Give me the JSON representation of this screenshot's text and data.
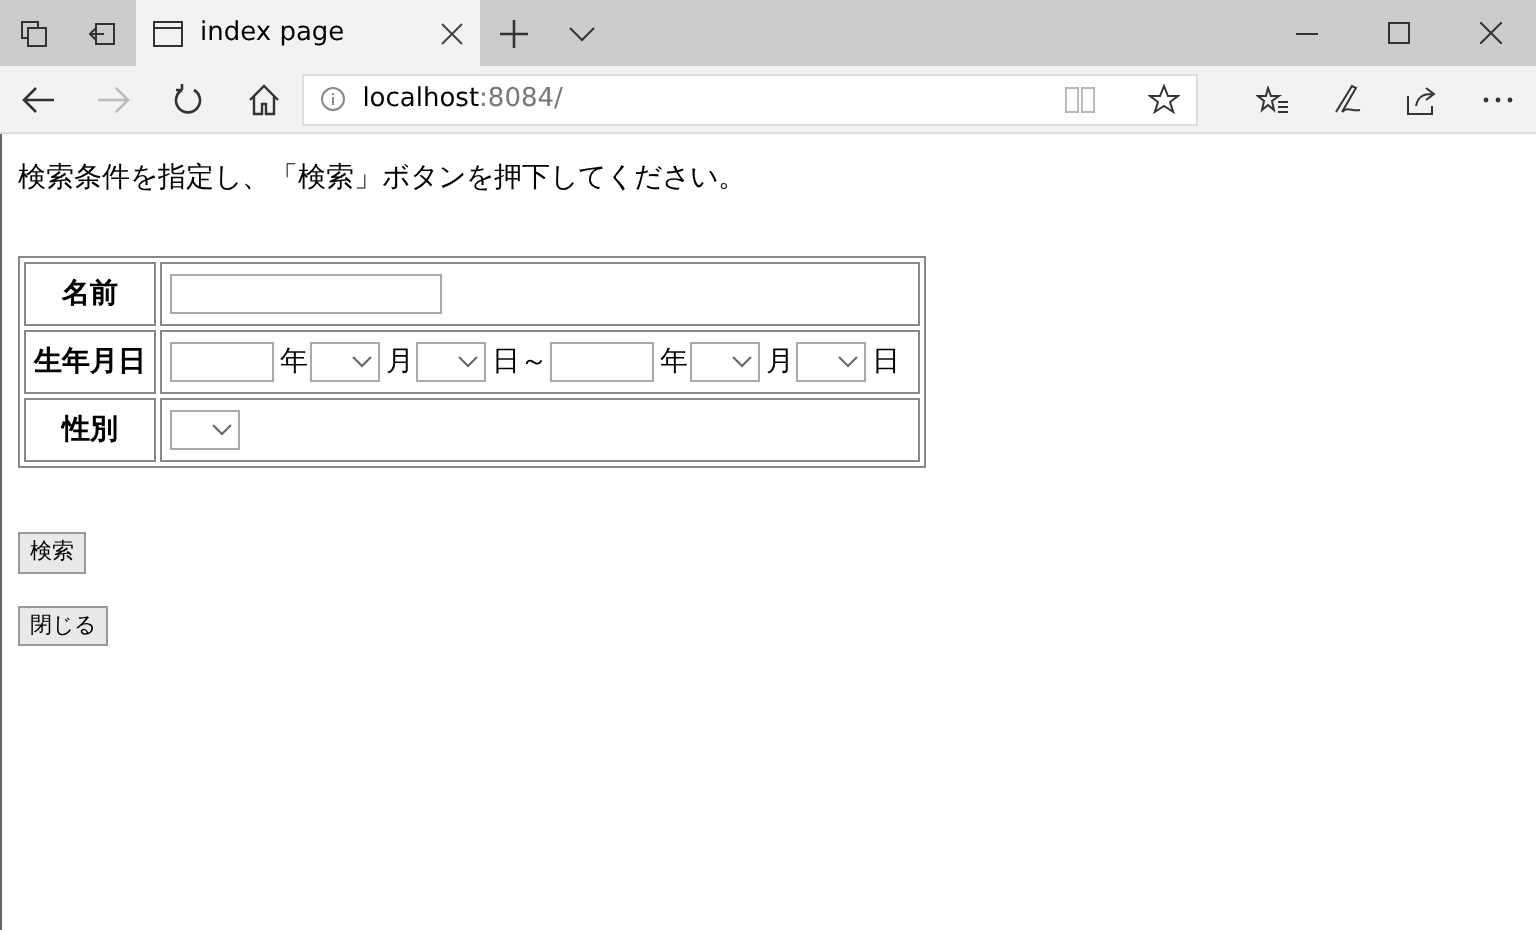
{
  "browser": {
    "tab_title": "index page",
    "url_host": "localhost",
    "url_rest": ":8084/"
  },
  "instruction": "検索条件を指定し、「検索」ボタンを押下してください。",
  "form_rows": [
    {
      "label": "名前",
      "fields": [
        {
          "kind": "longtext"
        }
      ]
    },
    {
      "label": "生年月日",
      "fields": [
        {
          "kind": "text"
        },
        {
          "kind": "unit",
          "text": "年"
        },
        {
          "kind": "select"
        },
        {
          "kind": "unit",
          "text": "月"
        },
        {
          "kind": "select"
        },
        {
          "kind": "unit",
          "text": "日～"
        },
        {
          "kind": "text"
        },
        {
          "kind": "unit",
          "text": "年"
        },
        {
          "kind": "select"
        },
        {
          "kind": "unit",
          "text": "月"
        },
        {
          "kind": "select"
        },
        {
          "kind": "unit",
          "text": "日"
        }
      ]
    },
    {
      "label": "性別",
      "fields": [
        {
          "kind": "select"
        }
      ]
    }
  ],
  "buttons": [
    "検索",
    "閉じる"
  ]
}
